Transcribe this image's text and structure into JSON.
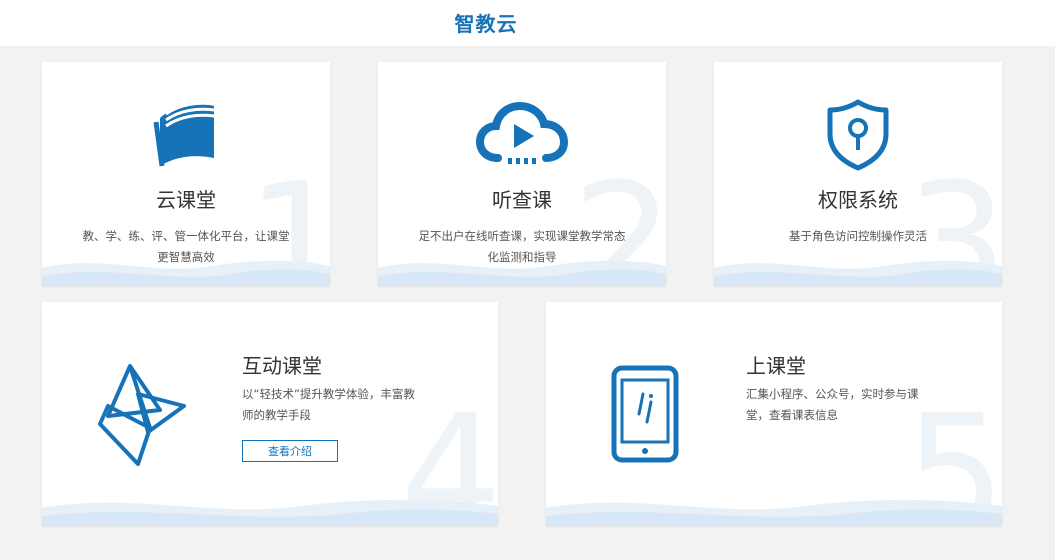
{
  "header": {
    "brand": "智教云"
  },
  "cards": [
    {
      "number": "1",
      "title": "云课堂",
      "desc": "教、学、练、评、管一体化平台，让课堂更智慧高效",
      "icon": "book-icon"
    },
    {
      "number": "2",
      "title": "听查课",
      "desc": "足不出户在线听查课，实现课堂教学常态化监测和指导",
      "icon": "cloud-play-icon"
    },
    {
      "number": "3",
      "title": "权限系统",
      "desc": "基于角色访问控制操作灵活",
      "icon": "shield-key-icon"
    },
    {
      "number": "4",
      "title": "互动课堂",
      "desc": "以“轻技术”提升教学体验，丰富教师的教学手段",
      "button": "查看介绍",
      "icon": "interactive-triangles-icon"
    },
    {
      "number": "5",
      "title": "上课堂",
      "desc": "汇集小程序、公众号，实时参与课堂，查看课表信息",
      "icon": "tablet-icon"
    }
  ],
  "colors": {
    "accent": "#1673b8",
    "background": "#f2f2f2",
    "card": "#ffffff"
  }
}
